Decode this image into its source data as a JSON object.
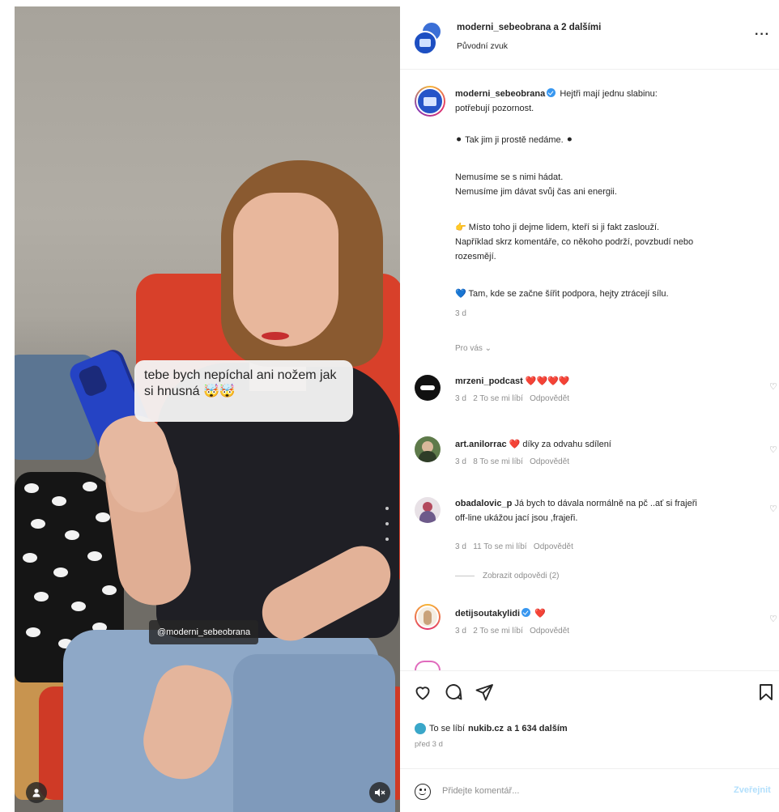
{
  "media": {
    "overlay_text": "tebe bych nepíchal ani nožem jak si hnusná 🤯🤯",
    "tag": "@moderni_sebeobrana"
  },
  "header": {
    "title": "moderni_sebeobrana a 2 dalšími",
    "subtitle": "Původní zvuk",
    "more": "···"
  },
  "caption": {
    "username": "moderni_sebeobrana",
    "line1": "Hejtři mají jednu slabinu:",
    "line2": "potřebují pozornost.",
    "p2": "⚫ Tak jim ji prostě nedáme. ⚫",
    "p3a": "Nemusíme se s nimi hádat.",
    "p3b": "Nemusíme jim dávat svůj čas ani energii.",
    "p4a": "👉 Místo toho ji dejme lidem, kteří si ji fakt zaslouží.",
    "p4b": "Například skrz komentáře, co někoho podrží, povzbudí nebo",
    "p4c": "rozesmějí.",
    "p5": "💙 Tam, kde se začne šířit podpora, hejty ztrácejí sílu.",
    "time": "3 d",
    "for_you": "Pro vás ⌄"
  },
  "comments": [
    {
      "username": "mrzeni_podcast",
      "text": "❤️❤️❤️❤️",
      "time": "3 d",
      "likes": "2 To se mi líbí",
      "reply": "Odpovědět"
    },
    {
      "username": "art.anilorrac",
      "text": "❤️  díky za odvahu sdílení",
      "time": "3 d",
      "likes": "8 To se mi líbí",
      "reply": "Odpovědět"
    },
    {
      "username": "obadalovic_p",
      "text": "Já bych to dávala normálně na pč ..ať si frajeři",
      "text2": "off-line ukážou jací jsou ,frajeři.",
      "time": "3 d",
      "likes": "11 To se mi líbí",
      "reply": "Odpovědět"
    },
    {
      "username": "detijsoutakylidi",
      "text": "❤️",
      "time": "3 d",
      "likes": "2 To se mi líbí",
      "reply": "Odpovědět"
    }
  ],
  "view_replies": "Zobrazit odpovědi (2)",
  "likes": {
    "prefix": "To se líbí",
    "user": "nukib.cz",
    "suffix": "a 1 634 dalším"
  },
  "post_time": "před 3 d",
  "comment_input": {
    "placeholder": "Přidejte komentář..."
  },
  "post_button": "Zveřejnit",
  "icons": [
    "heart-icon",
    "comment-icon",
    "share-icon",
    "bookmark-icon",
    "emoji-icon",
    "user-tag-icon",
    "mute-icon",
    "more-icon"
  ],
  "colors": {
    "accent": "#3897f0",
    "like_red": "#ed4956",
    "muted": "#8e8e8e"
  }
}
